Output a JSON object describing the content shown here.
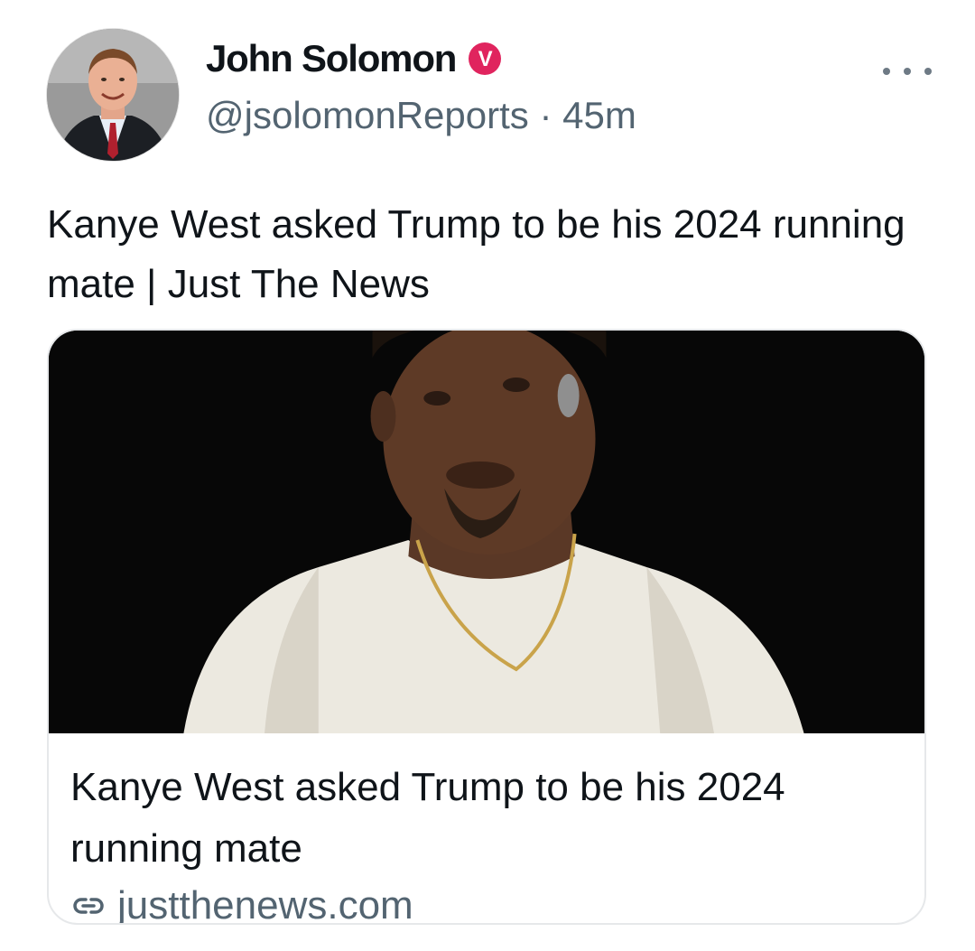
{
  "author": {
    "display_name": "John Solomon",
    "handle": "@jsolomonReports",
    "separator": "·",
    "time": "45m",
    "verified_badge_letter": "V"
  },
  "tweet": {
    "text": "Kanye West asked Trump to be his 2024 running mate | Just The News"
  },
  "card": {
    "title": "Kanye West asked Trump to be his 2024 running mate",
    "domain": "justthenews.com"
  },
  "colors": {
    "badge": "#e0245e",
    "secondary_text": "#536471",
    "primary_text": "#0f1419"
  },
  "icons": {
    "more": "more-options-icon",
    "verified": "verified-badge-icon",
    "link": "link-icon"
  }
}
